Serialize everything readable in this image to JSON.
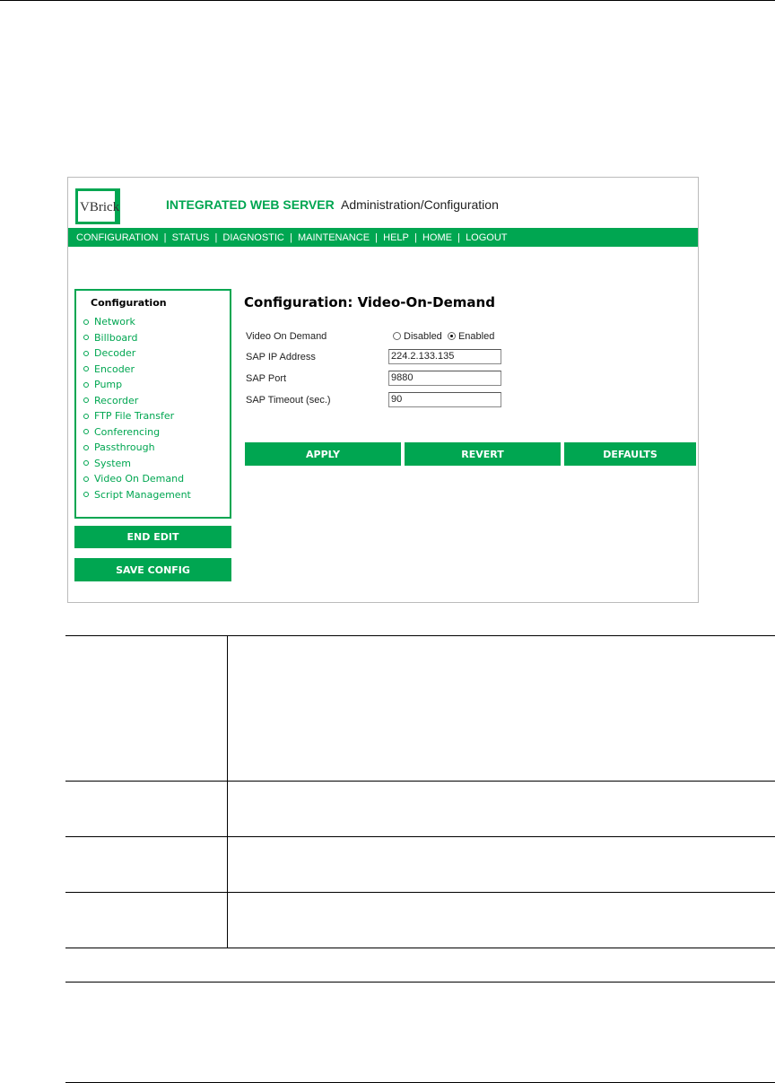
{
  "header": {
    "logo": "VBrick",
    "title": "INTEGRATED WEB SERVER",
    "subtitle": "Administration/Configuration"
  },
  "nav": [
    "CONFIGURATION",
    "STATUS",
    "DIAGNOSTIC",
    "MAINTENANCE",
    "HELP",
    "HOME",
    "LOGOUT"
  ],
  "sidebar": {
    "heading": "Configuration",
    "items": [
      "Network",
      "Billboard",
      "Decoder",
      "Encoder",
      "Pump",
      "Recorder",
      "FTP File Transfer",
      "Conferencing",
      "Passthrough",
      "System",
      "Video On Demand",
      "Script Management"
    ],
    "end_edit": "END EDIT",
    "save_config": "SAVE CONFIG"
  },
  "page": {
    "title": "Configuration: Video-On-Demand",
    "vod_label": "Video On Demand",
    "disabled": "Disabled",
    "enabled": "Enabled",
    "selected": "Enabled",
    "sap_ip_label": "SAP IP Address",
    "sap_ip": "224.2.133.135",
    "sap_port_label": "SAP Port",
    "sap_port": "9880",
    "sap_timeout_label": "SAP Timeout (sec.)",
    "sap_timeout": "90",
    "apply": "APPLY",
    "revert": "REVERT",
    "defaults": "DEFAULTS"
  },
  "colors": {
    "accent": "#00a651"
  }
}
